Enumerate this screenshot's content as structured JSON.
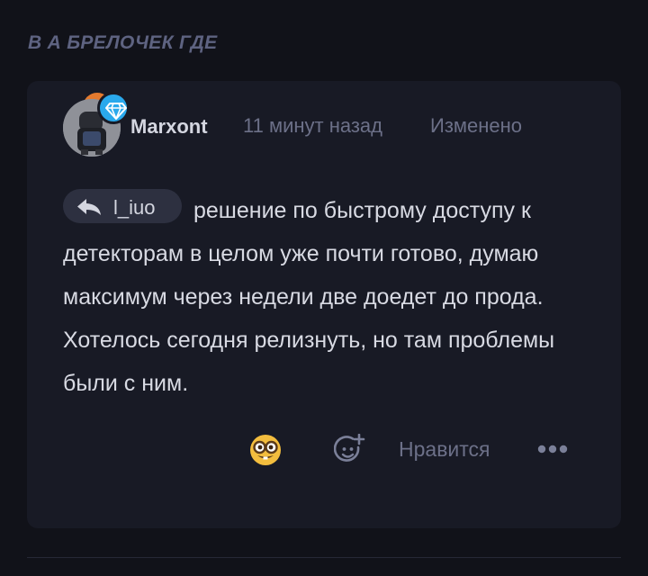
{
  "section": {
    "title": "В А БРЕЛОЧЕК ГДЕ"
  },
  "comment": {
    "author": "Marxont",
    "time": "11 минут назад",
    "edited": "Изменено",
    "reply_to": "l_iuo",
    "text": "решение по быстрому доступу к детекторам в целом уже почти готово, думаю максимум через недели две доедет до прода. Хотелось сегодня релизнуть, но там проблемы были с ним.",
    "reactions": {
      "like_label": "Нравится"
    }
  },
  "icons": {
    "badge": "diamond-icon",
    "reply": "reply-arrow-icon",
    "reaction": "nerd-face-emoji",
    "add_reaction": "add-reaction-icon",
    "more": "more-dots-icon"
  },
  "colors": {
    "background": "#111219",
    "card": "#181a25",
    "badge": "#2aa9ec",
    "muted_text": "#6c7088"
  }
}
